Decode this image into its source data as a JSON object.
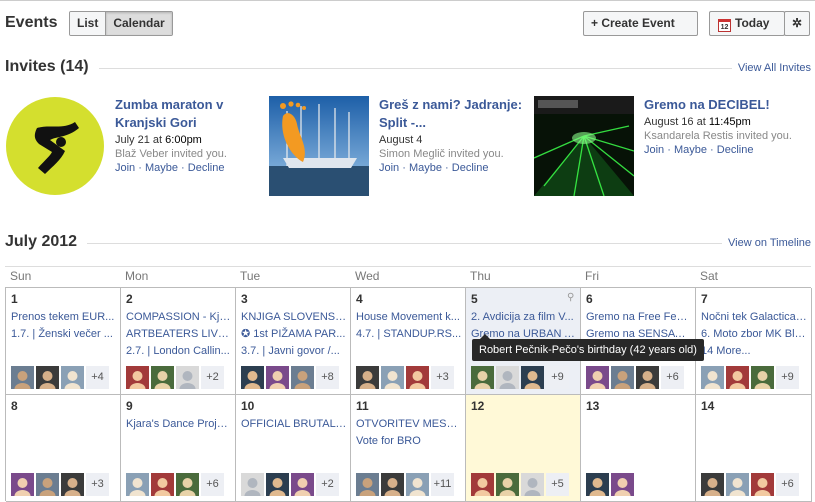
{
  "header": {
    "title": "Events",
    "list_label": "List",
    "calendar_label": "Calendar",
    "create_label": "+ Create Event",
    "today_label": "Today",
    "calendar_icon_num": "12",
    "gear_glyph": "✲"
  },
  "invites": {
    "title": "Invites (14)",
    "view_all": "View All Invites",
    "items": [
      {
        "name": "Zumba maraton v Kranjski Gori",
        "date": "July 21 at",
        "time": "6:00pm",
        "by": "Blaž Veber invited you.",
        "join": "Join",
        "maybe": "Maybe",
        "decline": "Decline",
        "sep": " · "
      },
      {
        "name": "Greš z nami? Jadranje: Split -...",
        "date": "August 4",
        "time": "",
        "by": "Simon Meglič invited you.",
        "join": "Join",
        "maybe": "Maybe",
        "decline": "Decline",
        "sep": " · "
      },
      {
        "name": "Gremo na DECIBEL!",
        "date": "August 16 at",
        "time": "11:45pm",
        "by": "Ksandarela Restis invited you.",
        "join": "Join",
        "maybe": "Maybe",
        "decline": "Decline",
        "sep": " · "
      }
    ]
  },
  "month": {
    "title": "July 2012",
    "view_timeline": "View on Timeline",
    "weekdays": [
      "Sun",
      "Mon",
      "Tue",
      "Wed",
      "Thu",
      "Fri",
      "Sat"
    ],
    "tooltip": "Robert Pečnik-Pečo's birthday (42 years old)",
    "weeks": [
      [
        {
          "day": "1",
          "events": [
            "Prenos tekem EUR...",
            "1.7. | Ženski večer ..."
          ],
          "more": "+4"
        },
        {
          "day": "2",
          "events": [
            "COMPASSION - Kja...",
            "ARTBEATERS LIVE f...",
            "2.7. | London Callin..."
          ],
          "more": "+2"
        },
        {
          "day": "3",
          "events": [
            "KNJIGA SLOVENSKE...",
            "✪ 1st PIŽAMA PAR...",
            "3.7. | Javni govor /..."
          ],
          "more": "+8"
        },
        {
          "day": "4",
          "events": [
            "House Movement k...",
            "4.7. | STANDUP.RS..."
          ],
          "more": "+3"
        },
        {
          "day": "5",
          "events": [
            "2. Avdicija za film V...",
            "Gremo na URBAN A..."
          ],
          "more": "+9"
        },
        {
          "day": "6",
          "events": [
            "Gremo na Free Fest...",
            "Gremo na SENSATI..."
          ],
          "more": "+6"
        },
        {
          "day": "7",
          "events": [
            "Nočni tek Galactica ...",
            "6. Moto zbor MK Bla...",
            "14 More..."
          ],
          "more": "+9"
        }
      ],
      [
        {
          "day": "8",
          "events": [],
          "more": "+3"
        },
        {
          "day": "9",
          "events": [
            "Kjara's Dance Proje..."
          ],
          "more": "+6"
        },
        {
          "day": "10",
          "events": [
            "OFFICIAL BRUTAL ..."
          ],
          "more": "+2"
        },
        {
          "day": "11",
          "events": [
            "OTVORITEV MESTN...",
            "Vote for BRO"
          ],
          "more": "+11"
        },
        {
          "day": "12",
          "events": [],
          "more": "+5"
        },
        {
          "day": "13",
          "events": [],
          "more": ""
        },
        {
          "day": "14",
          "events": [],
          "more": "+6"
        }
      ]
    ]
  },
  "colors": {
    "link": "#3b5998",
    "today_bg": "#fff9d7",
    "selected_bg": "#eceff5",
    "zumba_bg": "#d4df2e"
  }
}
